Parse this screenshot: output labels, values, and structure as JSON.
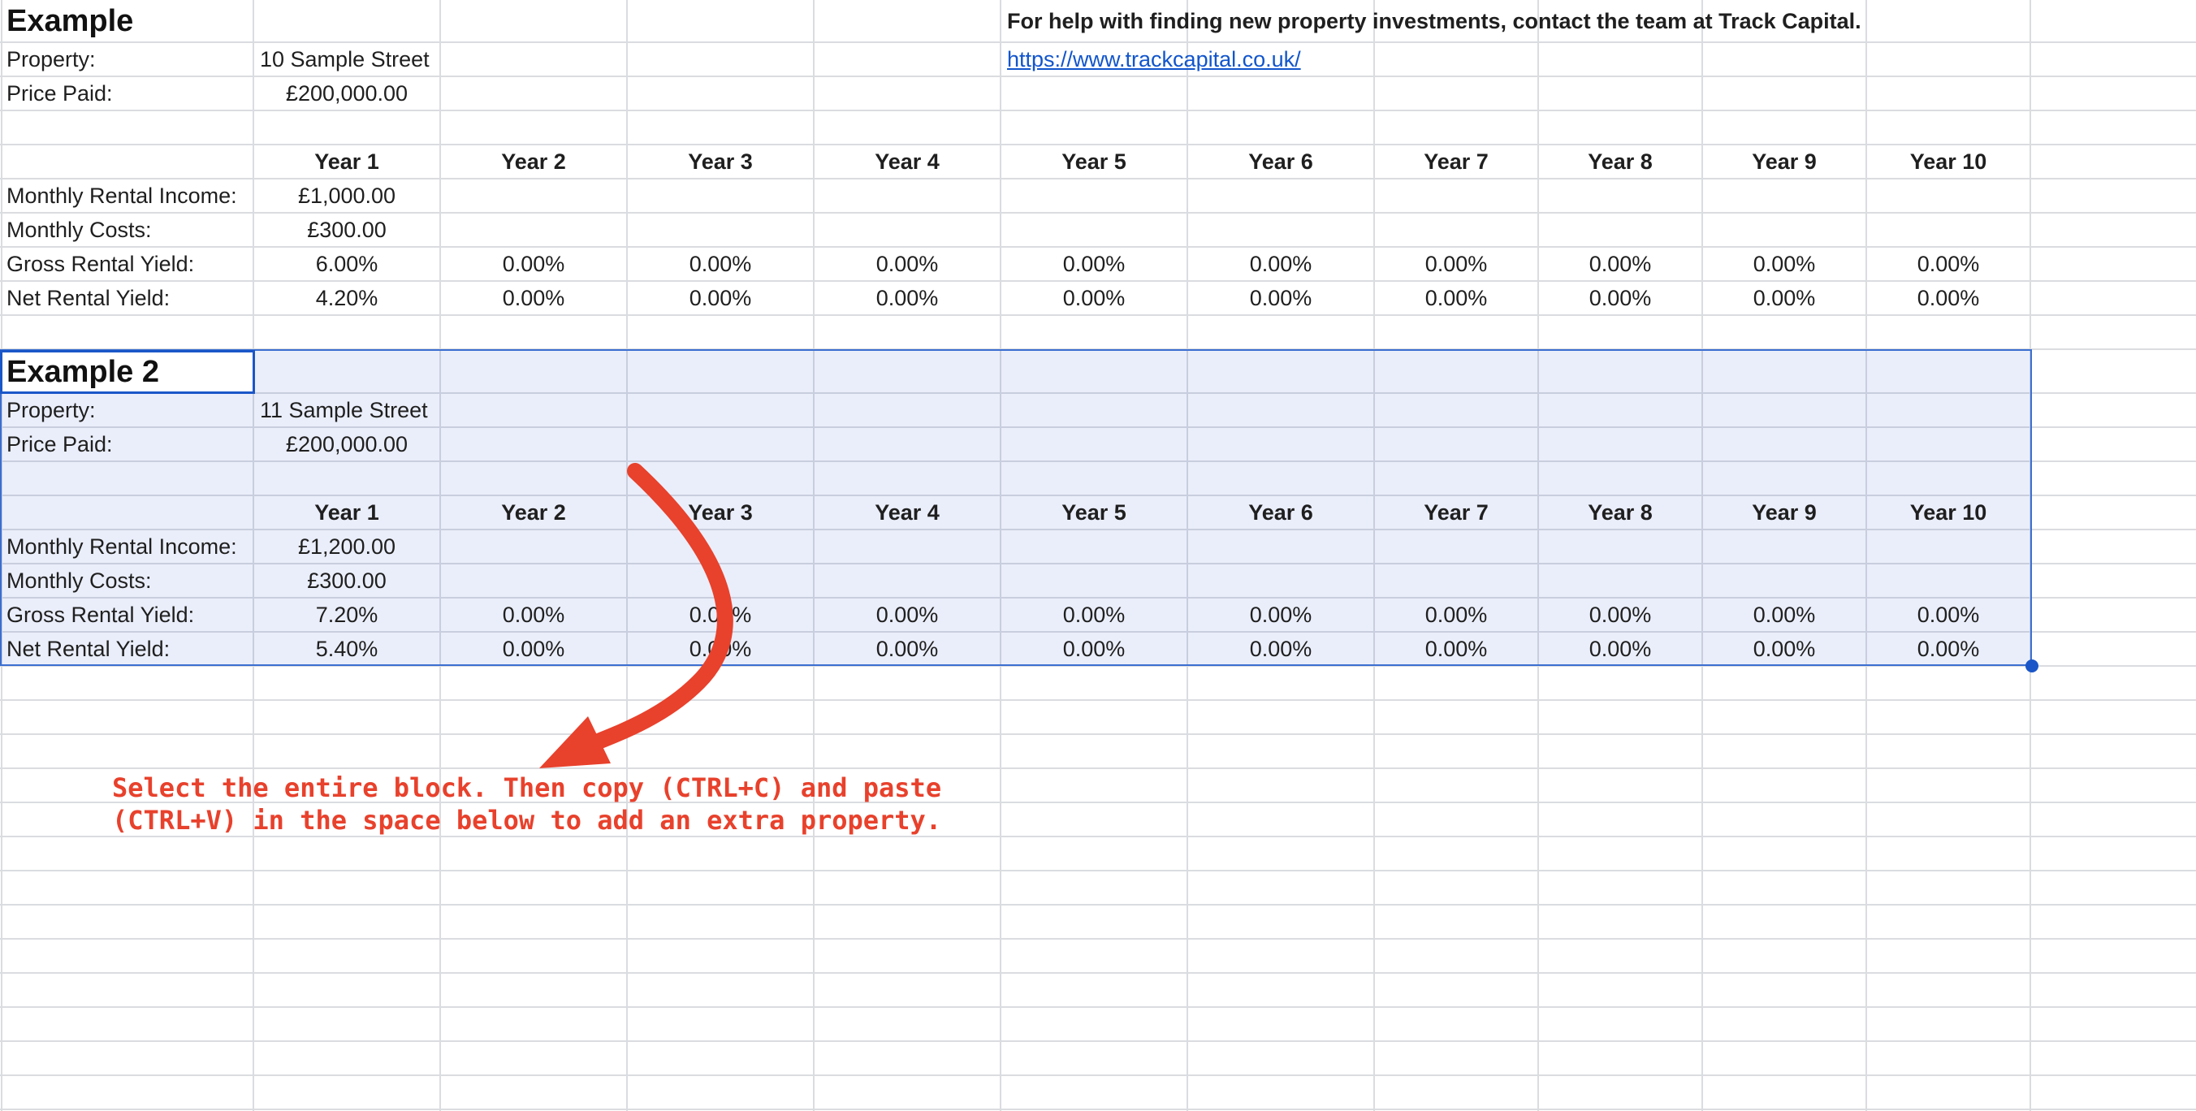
{
  "help_text": "For help with finding new property investments, contact the team at Track Capital.",
  "help_link": "https://www.trackcapital.co.uk/",
  "labels": {
    "property": "Property:",
    "price_paid": "Price Paid:",
    "monthly_rental_income": "Monthly Rental Income:",
    "monthly_costs": "Monthly Costs:",
    "gross_rental_yield": "Gross Rental Yield:",
    "net_rental_yield": "Net Rental Yield:"
  },
  "years": [
    "Year 1",
    "Year 2",
    "Year 3",
    "Year 4",
    "Year 5",
    "Year 6",
    "Year 7",
    "Year 8",
    "Year 9",
    "Year 10"
  ],
  "blocks": [
    {
      "title": "Example",
      "property": "10 Sample Street",
      "price_paid": "£200,000.00",
      "monthly_rental_income": "£1,000.00",
      "monthly_costs": "£300.00",
      "gross": [
        "6.00%",
        "0.00%",
        "0.00%",
        "0.00%",
        "0.00%",
        "0.00%",
        "0.00%",
        "0.00%",
        "0.00%",
        "0.00%"
      ],
      "net": [
        "4.20%",
        "0.00%",
        "0.00%",
        "0.00%",
        "0.00%",
        "0.00%",
        "0.00%",
        "0.00%",
        "0.00%",
        "0.00%"
      ]
    },
    {
      "title": "Example 2",
      "property": "11 Sample Street",
      "price_paid": "£200,000.00",
      "monthly_rental_income": "£1,200.00",
      "monthly_costs": "£300.00",
      "gross": [
        "7.20%",
        "0.00%",
        "0.00%",
        "0.00%",
        "0.00%",
        "0.00%",
        "0.00%",
        "0.00%",
        "0.00%",
        "0.00%"
      ],
      "net": [
        "5.40%",
        "0.00%",
        "0.00%",
        "0.00%",
        "0.00%",
        "0.00%",
        "0.00%",
        "0.00%",
        "0.00%",
        "0.00%"
      ]
    }
  ],
  "instruction": {
    "line1": "Select the entire block. Then copy (CTRL+C) and paste",
    "line2": "(CTRL+V) in the space below to add an extra property."
  },
  "colors": {
    "selection": "#3b6fd1",
    "annotation": "#e8412c",
    "link": "#1155cc"
  }
}
